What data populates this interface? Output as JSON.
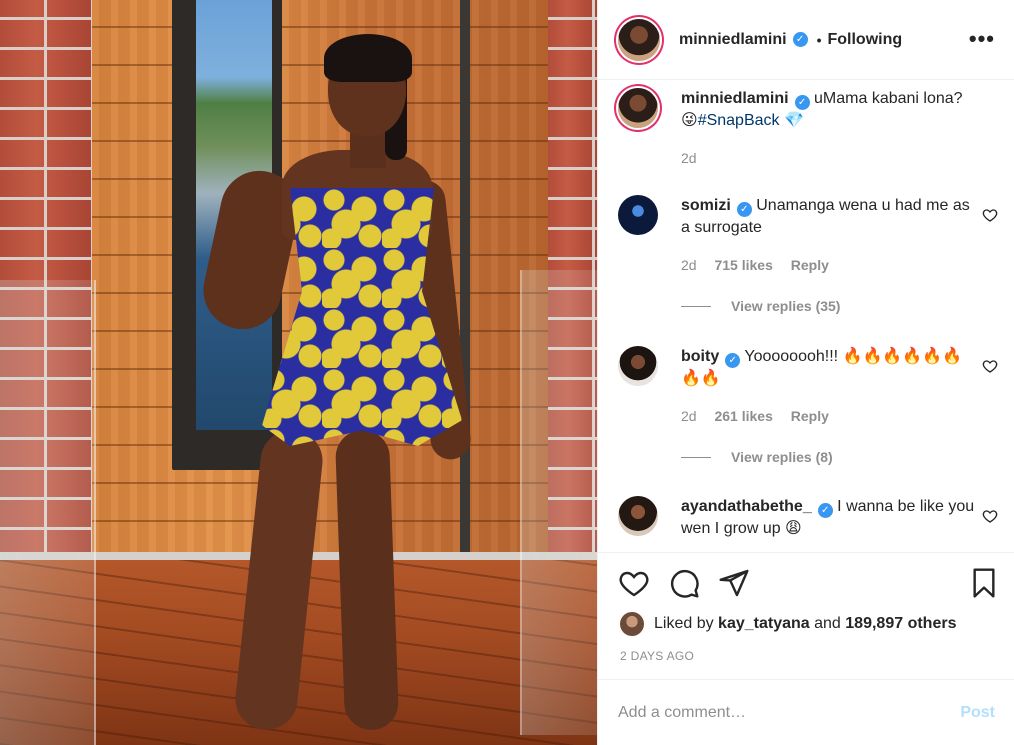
{
  "post": {
    "author": "minniedlamini",
    "author_verified_mark": "✓",
    "separator": "•",
    "following_label": "Following",
    "more_options": "•••"
  },
  "caption": {
    "username": "minniedlamini",
    "verified_mark": "✓",
    "text": "uMama kabani lona?",
    "emoji": "😜",
    "hashtag": "#SnapBack",
    "trailing_emoji": "💎",
    "time": "2d"
  },
  "comments": [
    {
      "username": "somizi",
      "verified_mark": "✓",
      "text": "Unamanga wena u had me as a surrogate",
      "time": "2d",
      "likes": "715 likes",
      "reply_label": "Reply",
      "view_replies": "View replies (35)"
    },
    {
      "username": "boity",
      "verified_mark": "✓",
      "text": "Yoooooooh!!! 🔥🔥🔥🔥🔥🔥🔥🔥",
      "time": "2d",
      "likes": "261 likes",
      "reply_label": "Reply",
      "view_replies": "View replies (8)"
    },
    {
      "username": "ayandathabethe_",
      "verified_mark": "✓",
      "text": "I wanna be like you wen I grow up 😩"
    }
  ],
  "actions": {
    "like_icon": "heart-icon",
    "comment_icon": "comment-icon",
    "share_icon": "send-icon",
    "save_icon": "bookmark-icon"
  },
  "likes": {
    "prefix": "Liked by",
    "user": "kay_tatyana",
    "connector": "and",
    "others": "189,897 others"
  },
  "date_label": "2 DAYS AGO",
  "add_comment": {
    "placeholder": "Add a comment…",
    "post_label": "Post"
  },
  "colors": {
    "verified": "#3897f0",
    "story_ring": "#e1306c",
    "hashtag": "#00376b",
    "muted": "#8e8e8e",
    "post_disabled": "#b2dffc"
  }
}
